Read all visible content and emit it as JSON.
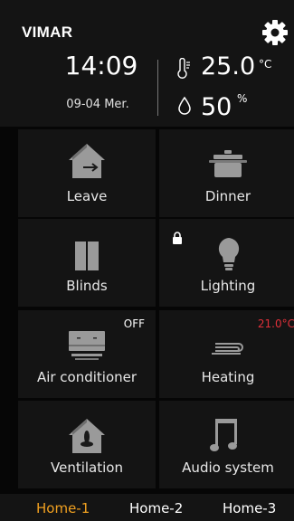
{
  "header": {
    "brand": "VIMAR",
    "time": "14:09",
    "date": "09-04 Mer.",
    "temperature": "25.0",
    "temperature_unit": "°C",
    "humidity": "50",
    "humidity_unit": "%"
  },
  "tiles": [
    {
      "label": "Leave",
      "icon": "house-exit-icon"
    },
    {
      "label": "Dinner",
      "icon": "pot-icon"
    },
    {
      "label": "Blinds",
      "icon": "blinds-icon"
    },
    {
      "label": "Lighting",
      "icon": "bulb-icon",
      "badge_icon": "lock-icon"
    },
    {
      "label": "Air conditioner",
      "icon": "air-conditioner-icon",
      "badge": "OFF"
    },
    {
      "label": "Heating",
      "icon": "heating-icon",
      "badge": "21.0°C"
    },
    {
      "label": "Ventilation",
      "icon": "fan-house-icon"
    },
    {
      "label": "Audio system",
      "icon": "music-note-icon"
    }
  ],
  "tabs": [
    {
      "label": "Home-1",
      "active": true
    },
    {
      "label": "Home-2",
      "active": false
    },
    {
      "label": "Home-3",
      "active": false
    }
  ],
  "colors": {
    "accent": "#f0a020",
    "heating_setpoint": "#e0303a",
    "tile_bg": "#141414",
    "page_bg": "#060606"
  }
}
